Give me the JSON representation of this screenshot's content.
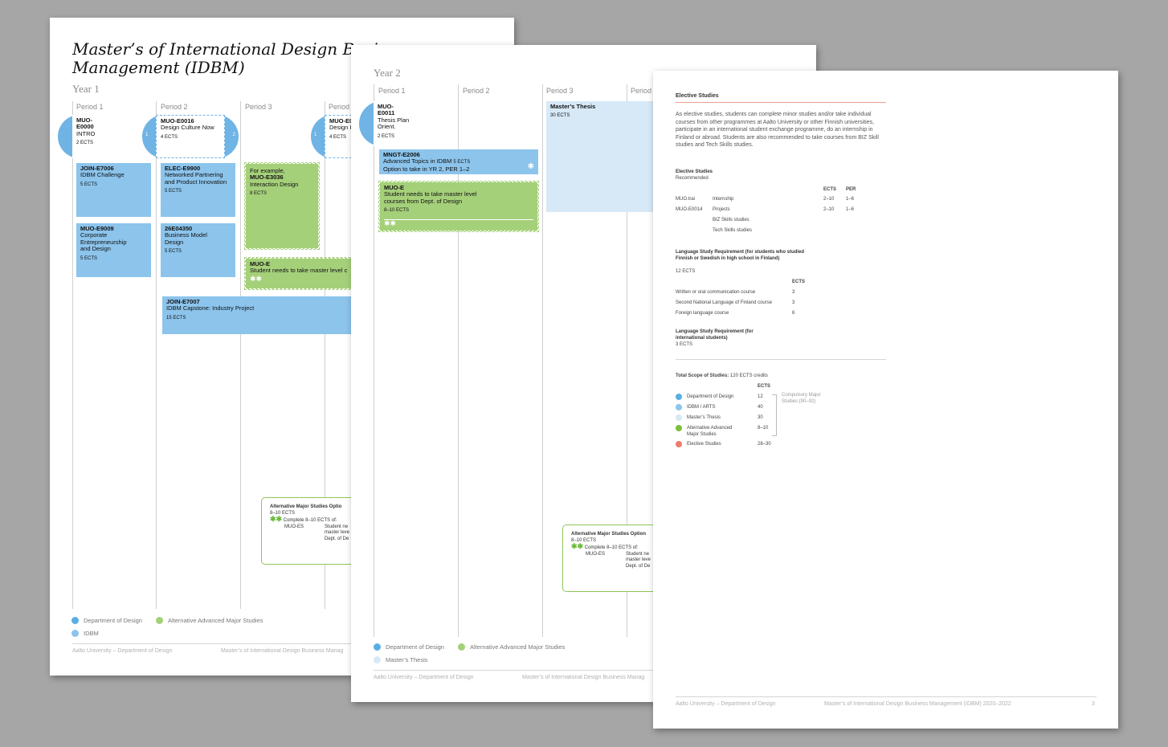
{
  "page1": {
    "title": "Master’s of International Design Business Management (IDBM)",
    "year": "Year 1",
    "periods": [
      "Period 1",
      "Period 2",
      "Period 3",
      "Period 4"
    ],
    "cards": {
      "intro_code": "MUO-E0000",
      "intro_name": "INTRO",
      "intro_ects": "2 ECTS",
      "culture_code": "MUO-E0016",
      "culture_name": "Design Culture Now",
      "culture_ects": "4 ECTS",
      "p4_code": "MUO-E0",
      "p4_name": "Design I",
      "p4_ects": "4 ECTS",
      "c1_code": "JOIN-E7006",
      "c1_name": "IDBM Challenge",
      "c1_ects": "5 ECTS",
      "c2_code": "MUO-E9009",
      "c2_name": "Corporate Entrepreneurship and Design",
      "c2_ects": "5 ECTS",
      "c3_code": "ELEC-E9900",
      "c3_name": "Networked Partnering and Product Innovation",
      "c3_ects": "5 ECTS",
      "c4_code": "26E04350",
      "c4_name": "Business Model Design",
      "c4_ects": "5 ECTS",
      "c5_pre": "For example,",
      "c5_code": "MUO-E3036",
      "c5_name": "Interaction Design",
      "c5_ects": "8 ECTS",
      "c6_code": "MUO-E",
      "c6_name": "Student needs to take master level c",
      "c6_stars": "✱✱",
      "c7_code": "JOIN-E7007",
      "c7_name": "IDBM Capstone: Industry Project",
      "c7_ects": "15 ECTS",
      "num1": "1",
      "num2": "2",
      "num3": "1"
    },
    "alt": {
      "title": "Alternative Major Studies Optio",
      "ects": "8–10 ECTS",
      "stars": "✱✱",
      "complete": "Complete 8–10 ECTS of:",
      "code": "MUO-ES",
      "desc": "Student ne master leve Dept. of De"
    },
    "legend": [
      "Department of Design",
      "Alternative Advanced Major Studies",
      "IDBM"
    ],
    "footer_left": "Aalto University – Department of Design",
    "footer_mid": "Master’s of International Design Business Manag"
  },
  "page2": {
    "year": "Year 2",
    "periods": [
      "Period 1",
      "Period 2",
      "Period 3",
      "Period"
    ],
    "cards": {
      "thesis_plan_code": "MUO-E0011",
      "thesis_plan_name": "Thesis Plan Orient.",
      "thesis_plan_ects": "2 ECTS",
      "mngt_code": "MNGT-E2006",
      "mngt_name": "Advanced Topics in IDBM",
      "mngt_ects_inline": "5 ECTS",
      "mngt_note": "Option to take in YR 2, PER 1–2",
      "mngt_star": "✱",
      "muoe_code": "MUO-E",
      "muoe_name": "Student needs to take master level courses from Dept. of Design",
      "muoe_ects": "8–10 ECTS",
      "muoe_stars": "✱✱",
      "thesis_code": "Master’s Thesis",
      "thesis_ects": "30 ECTS"
    },
    "alt": {
      "title": "Alternative Major Studies Option",
      "ects": "8–10 ECTS",
      "stars": "✱✱",
      "complete": "Complete 8–10 ECTS of:",
      "code": "MUO-ES",
      "desc": "Student ne master leve Dept. of De"
    },
    "legend": [
      "Department of Design",
      "Alternative Advanced Major Studies",
      "Master’s Thesis"
    ],
    "footer_left": "Aalto University – Department of Design",
    "footer_mid": "Master’s of International Design Business Manag"
  },
  "page3": {
    "heading": "Elective Studies",
    "intro": "As elective studies, students can complete minor studies and/or take individual courses from other programmes at Aalto University or other Finnish universities, participate in an international student exchange programme, do an internship in Finland or abroad. Students are also recommended to take courses from BIZ Skill studies and Tech Skills studies.",
    "elective": {
      "title": "Elective Studies",
      "subtitle": "Recommended",
      "col_ects": "ECTS",
      "col_per": "PER",
      "rows": [
        {
          "code": "MUO.trai",
          "name": "Internship",
          "ects": "2–10",
          "per": "1–6"
        },
        {
          "code": "MUO-E0014",
          "name": "Projects",
          "ects": "2–10",
          "per": "1–6"
        },
        {
          "code": "",
          "name": "BIZ Skills studies",
          "ects": "",
          "per": ""
        },
        {
          "code": "",
          "name": "Tech Skills studies",
          "ects": "",
          "per": ""
        }
      ]
    },
    "lang1": {
      "title": "Language Study Requirement (for students who studied Finnish or Swedish in high school in Finland)",
      "ects_total": "12 ECTS",
      "col_ects": "ECTS",
      "rows": [
        {
          "name": "Written or oral communication course",
          "ects": "3"
        },
        {
          "name": "Second National Language of Finland course",
          "ects": "3"
        },
        {
          "name": "Foreign language course",
          "ects": "6"
        }
      ]
    },
    "lang2": {
      "title": "Language Study Requirement (for international students)",
      "ects_total": "3 ECTS"
    },
    "total": {
      "title_bold": "Total Scope of Studies:",
      "title_rest": "120 ECTS credits",
      "col_ects": "ECTS",
      "rows": [
        {
          "name": "Department of Design",
          "ects": "12",
          "color": "#5aaee4"
        },
        {
          "name": "IDBM / ARTS",
          "ects": "40",
          "color": "#8cc4ec"
        },
        {
          "name": "Master’s Thesis",
          "ects": "30",
          "color": "#d7e9f7"
        },
        {
          "name": "Alternative Advanced Major Studies",
          "ects": "8–10",
          "color": "#7cbf3e"
        },
        {
          "name": "Elective Studies",
          "ects": "28–30",
          "color": "#f07a6a"
        }
      ],
      "bracket_note": "Compulsory Major Studies (90–92)"
    },
    "footer_left": "Aalto University – Department of Design",
    "footer_mid": "Master’s of International Design Business Management (IDBM)  2020–2022",
    "page_num": "3"
  },
  "colors": {
    "background": "#a6a6a6",
    "blue": "#8cc4ec",
    "dark_blue": "#5aaee4",
    "light_blue": "#d7e9f7",
    "green": "#a5d07a",
    "salmon": "#f07a6a"
  }
}
